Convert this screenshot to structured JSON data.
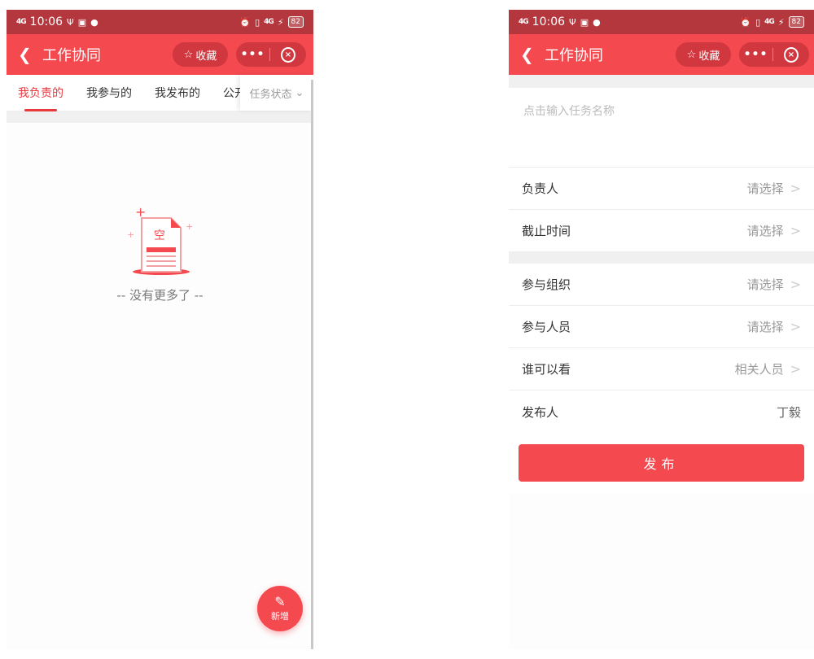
{
  "status_bar": {
    "time": "10:06",
    "signal": "4G",
    "battery": "82"
  },
  "nav": {
    "back_icon": "chevron-left-icon",
    "title": "工作协同",
    "favorite_label": "收藏",
    "more_label": "•••"
  },
  "left": {
    "tabs": [
      "我负责的",
      "我参与的",
      "我发布的",
      "公开"
    ],
    "filter_label": "任务状态",
    "empty_icon_text": "空",
    "empty_text": "-- 没有更多了 --",
    "fab_label": "新增"
  },
  "right": {
    "task_placeholder": "点击输入任务名称",
    "rows1": [
      {
        "label": "负责人",
        "value": "请选择"
      },
      {
        "label": "截止时间",
        "value": "请选择"
      }
    ],
    "rows2": [
      {
        "label": "参与组织",
        "value": "请选择"
      },
      {
        "label": "参与人员",
        "value": "请选择"
      },
      {
        "label": "谁可以看",
        "value": "相关人员"
      }
    ],
    "publisher": {
      "label": "发布人",
      "value": "丁毅"
    },
    "publish_button": "发布"
  },
  "colors": {
    "accent": "#f3494f",
    "statusbar": "#b3373d",
    "active_tab": "#e8393f"
  }
}
